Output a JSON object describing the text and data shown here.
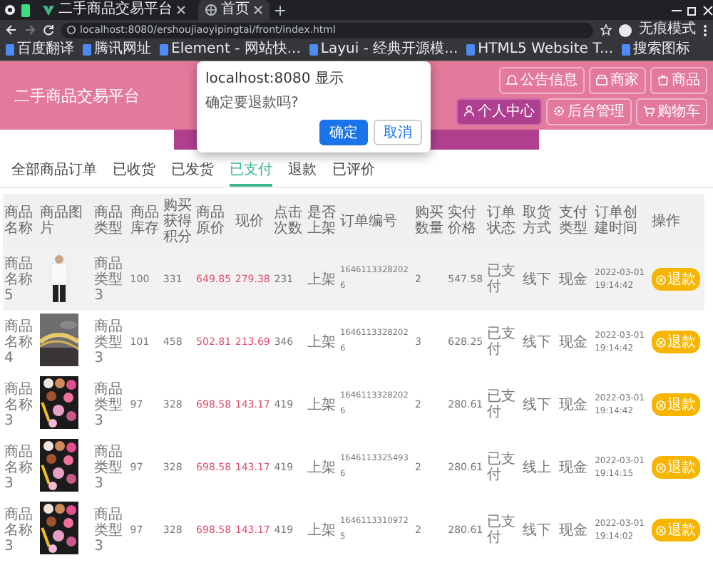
{
  "browser": {
    "tabs": [
      {
        "title": "二手商品交易平台",
        "selected": false
      },
      {
        "title": "首页",
        "selected": true
      }
    ],
    "url": "localhost:8080/ershoujiaoyipingtai/front/index.html",
    "profile": "无痕模式",
    "bookmarks": [
      {
        "label": "百度翻译"
      },
      {
        "label": "腾讯网址"
      },
      {
        "label": "Element - 网站快..."
      },
      {
        "label": "Layui - 经典开源模..."
      },
      {
        "label": "HTML5 Website T..."
      },
      {
        "label": "搜索图标"
      }
    ]
  },
  "header": {
    "title": "二手商品交易平台",
    "nav": [
      {
        "label": "公告信息",
        "selected": false
      },
      {
        "label": "商家",
        "selected": false
      },
      {
        "label": "商品",
        "selected": false
      },
      {
        "label": "个人中心",
        "selected": true
      },
      {
        "label": "后台管理",
        "selected": false
      },
      {
        "label": "购物车",
        "selected": false
      }
    ]
  },
  "dialog": {
    "origin": "localhost:8080 显示",
    "message": "确定要退款吗?",
    "buttons": [
      {
        "label": "确定",
        "primary": true
      },
      {
        "label": "取消",
        "primary": false
      }
    ]
  },
  "order_tabs": [
    {
      "label": "全部商品订单",
      "selected": false
    },
    {
      "label": "已收货",
      "selected": false
    },
    {
      "label": "已发货",
      "selected": false
    },
    {
      "label": "已支付",
      "selected": true
    },
    {
      "label": "退款",
      "selected": false
    },
    {
      "label": "已评价",
      "selected": false
    }
  ],
  "table": {
    "columns": [
      "商品名称",
      "商品图片",
      "商品类型",
      "商品库存",
      "购买获得积分",
      "商品原价",
      "现价",
      "点击次数",
      "是否上架",
      "订单编号",
      "购买数量",
      "实付价格",
      "订单状态",
      "取货方式",
      "支付类型",
      "订单创建时间",
      "操作"
    ],
    "rows": [
      {
        "hovered": true,
        "image": {
          "kind": "picture"
        },
        "cells": [
          "商品名称5",
          "",
          "商品类型3",
          "100",
          "331",
          "649.85",
          "279.38",
          "231",
          "上架",
          "16461133282026",
          "2",
          "547.58",
          "已支付",
          "线下",
          "现金",
          "2022-03-01 19:14:42"
        ],
        "action": "退款"
      },
      {
        "hovered": false,
        "image": {
          "kind": "picture"
        },
        "cells": [
          "商品名称4",
          "",
          "商品类型3",
          "101",
          "458",
          "502.81",
          "213.69",
          "346",
          "上架",
          "16461133282026",
          "3",
          "628.25",
          "已支付",
          "线下",
          "现金",
          "2022-03-01 19:14:42"
        ],
        "action": "退款"
      },
      {
        "hovered": false,
        "image": {
          "kind": "picture"
        },
        "cells": [
          "商品名称3",
          "",
          "商品类型3",
          "97",
          "328",
          "698.58",
          "143.17",
          "419",
          "上架",
          "16461133282026",
          "2",
          "280.61",
          "已支付",
          "线下",
          "现金",
          "2022-03-01 19:14:42"
        ],
        "action": "退款"
      },
      {
        "hovered": false,
        "image": {
          "kind": "picture"
        },
        "cells": [
          "商品名称3",
          "",
          "商品类型3",
          "97",
          "328",
          "698.58",
          "143.17",
          "419",
          "上架",
          "16461133254936",
          "2",
          "280.61",
          "已支付",
          "线上",
          "现金",
          "2022-03-01 19:14:15"
        ],
        "action": "退款"
      },
      {
        "hovered": false,
        "image": {
          "kind": "picture"
        },
        "cells": [
          "商品名称3",
          "",
          "商品类型3",
          "97",
          "328",
          "698.58",
          "143.17",
          "419",
          "上架",
          "16461133109725",
          "2",
          "280.61",
          "已支付",
          "线下",
          "现金",
          "2022-03-01 19:14:02"
        ],
        "action": "退款"
      }
    ]
  }
}
